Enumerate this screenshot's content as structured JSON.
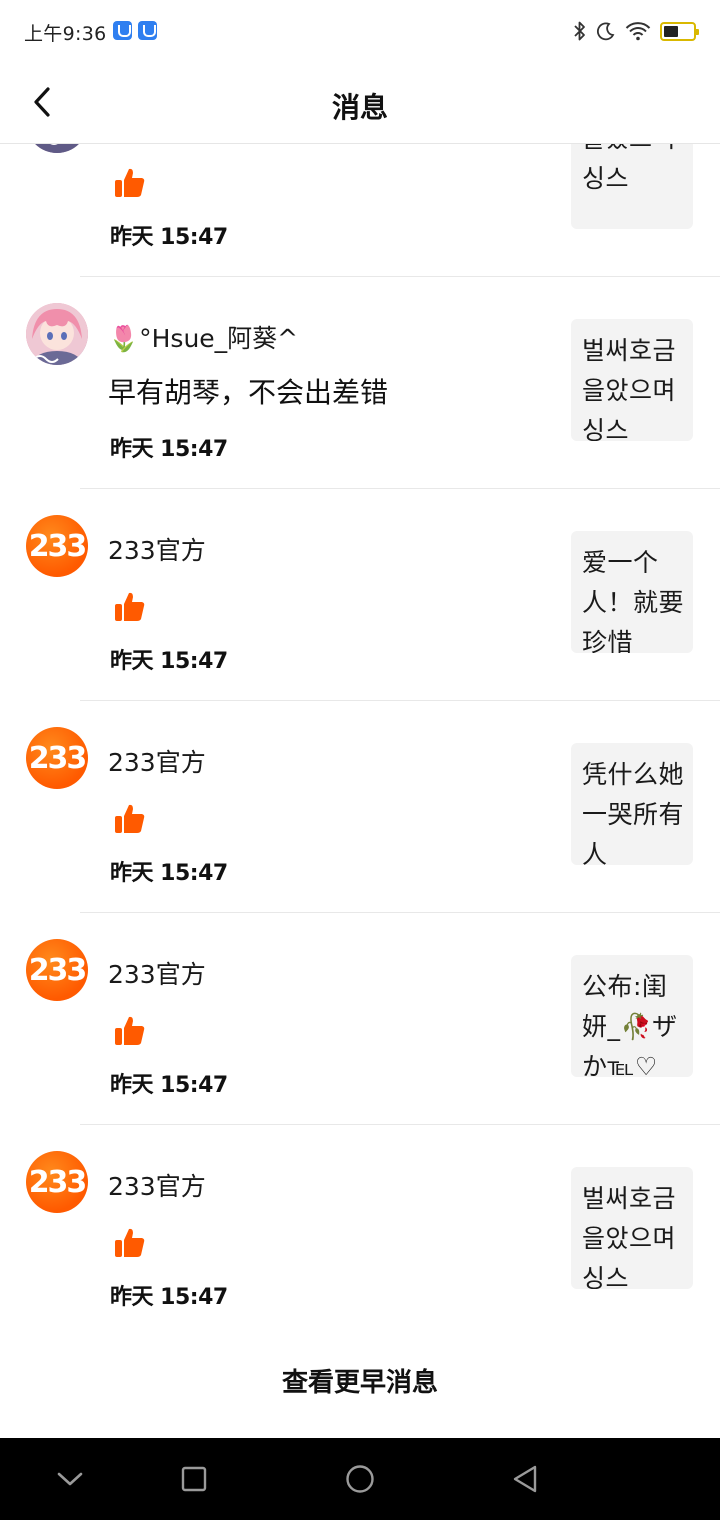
{
  "status_bar": {
    "time": "上午9:36",
    "icons": [
      "shield-notification-icon",
      "shield-notification-icon",
      "bluetooth-icon",
      "moon-icon",
      "wifi-icon",
      "battery-icon"
    ],
    "battery_color": "#d9b800"
  },
  "header": {
    "title": "消息",
    "back_icon": "chevron-left-icon"
  },
  "messages": [
    {
      "avatar": "anime-avatar",
      "name": "",
      "comment": "",
      "is_like": true,
      "time": "昨天 15:47",
      "preview": "벌써호금을았으며 싱스"
    },
    {
      "avatar": "anime-avatar",
      "name": "🌷°Hsue_阿葵^",
      "comment": "早有胡琴，不会出差错",
      "is_like": false,
      "time": "昨天 15:47",
      "preview": "벌써호금을았으며 싱스"
    },
    {
      "avatar": "233-logo",
      "avatar_text": "233",
      "name": "233官方",
      "comment": "",
      "is_like": true,
      "time": "昨天 15:47",
      "preview": "爱一个人！就要珍惜"
    },
    {
      "avatar": "233-logo",
      "avatar_text": "233",
      "name": "233官方",
      "comment": "",
      "is_like": true,
      "time": "昨天 15:47",
      "preview": "凭什么她一哭所有人"
    },
    {
      "avatar": "233-logo",
      "avatar_text": "233",
      "name": "233官方",
      "comment": "",
      "is_like": true,
      "time": "昨天 15:47",
      "preview": "公布:闺妍_🥀ザか℡♡"
    },
    {
      "avatar": "233-logo",
      "avatar_text": "233",
      "name": "233官方",
      "comment": "",
      "is_like": true,
      "time": "昨天 15:47",
      "preview": "벌써호금을았으며 싱스"
    }
  ],
  "load_more": "查看更早消息",
  "nav_bar": [
    "chevron-down-icon",
    "square-icon",
    "circle-icon",
    "triangle-back-icon"
  ],
  "colors": {
    "accent_orange": "#ff5a00",
    "like_orange": "#ff5a00"
  }
}
